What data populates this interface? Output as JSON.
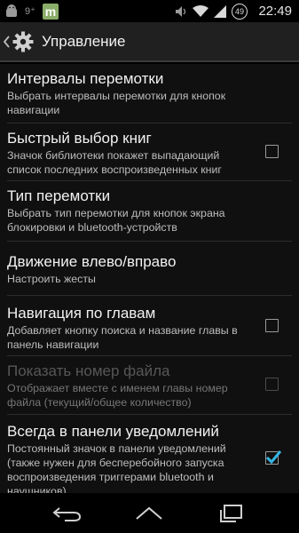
{
  "status_bar": {
    "time": "22:49",
    "battery_level": "49",
    "notification_badge": "9⁺",
    "icons": [
      "android-icon",
      "square-m-icon",
      "sound-icon",
      "wifi-icon",
      "signal-icon",
      "battery-icon"
    ]
  },
  "action_bar": {
    "title": "Управление",
    "icon": "gear-icon"
  },
  "preferences": [
    {
      "title": "Интервалы перемотки",
      "summary": "Выбрать интервалы перемотки для кнопок навигации",
      "checkbox": null,
      "enabled": true
    },
    {
      "title": "Быстрый выбор книг",
      "summary": "Значок библиотеки покажет выпадающий список последних воспроизведенных книг",
      "checkbox": false,
      "enabled": true
    },
    {
      "title": "Тип перемотки",
      "summary": "Выбрать тип перемотки для кнопок экрана блокировки и bluetooth-устройств",
      "checkbox": null,
      "enabled": true
    },
    {
      "title": "Движение влево/вправо",
      "summary": "Настроить жесты",
      "checkbox": null,
      "enabled": true
    },
    {
      "title": "Навигация по главам",
      "summary": "Добавляет кнопку поиска и название главы в панель навигации",
      "checkbox": false,
      "enabled": true
    },
    {
      "title": "Показать номер файла",
      "summary": "Отображает вместе с именем главы номер файла (текущий/общее количество)",
      "checkbox": false,
      "enabled": false
    },
    {
      "title": "Всегда в панели уведомлений",
      "summary": "Постоянный значок в панели уведомлений (также нужен для бесперебойного запуска воспроизведения триггерами bluetooth и наушников)",
      "checkbox": true,
      "enabled": true
    }
  ],
  "nav_bar": {
    "buttons": [
      "back-icon",
      "home-icon",
      "recents-icon"
    ]
  },
  "colors": {
    "accent": "#33b5e5",
    "background": "#101010",
    "action_bar": "#202020"
  }
}
